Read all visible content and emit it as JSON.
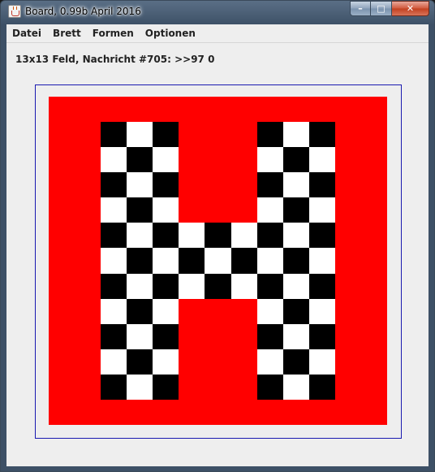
{
  "window": {
    "title": "Board, 0.99b April 2016",
    "icon": "java-cup-icon",
    "buttons": {
      "minimize": "minimize-icon",
      "maximize": "maximize-icon",
      "close": "close-icon"
    }
  },
  "menu": [
    "Datei",
    "Brett",
    "Formen",
    "Optionen"
  ],
  "status": "13x13 Feld, Nachricht #705: >>97 0",
  "board": {
    "size": 13,
    "colors": {
      "background": "#ff0000",
      "black": "#000000",
      "white": "#ffffff",
      "frame": "#1a1ab0"
    },
    "rows": [
      ".............",
      "..BWB...BWB..",
      "..WBW...WBW..",
      "..BWB...BWB..",
      "..WBW...WBW..",
      "..BWBWBWBWB..",
      "..WBWBWBWBW..",
      "..BWBWBWBWB..",
      "..WBW...WBW..",
      "..BWB...BWB..",
      "..WBW...WBW..",
      "..BWB...BWB..",
      "............."
    ]
  }
}
